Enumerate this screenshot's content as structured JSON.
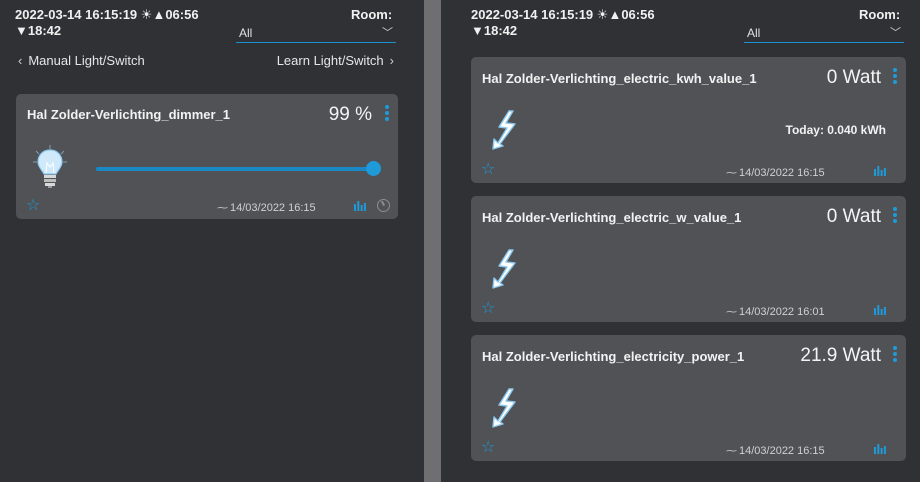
{
  "left": {
    "datetime": "2022-03-14 16:15:19",
    "sunrise": "06:56",
    "sunset": "18:42",
    "room_label": "Room:",
    "room_value": "All",
    "nav_prev": "Manual Light/Switch",
    "nav_next": "Learn Light/Switch",
    "card": {
      "title": "Hal Zolder-Verlichting_dimmer_1",
      "value": "99 %",
      "level_percent": 99,
      "timestamp": "14/03/2022 16:15"
    }
  },
  "right": {
    "datetime": "2022-03-14 16:15:19",
    "sunrise": "06:56",
    "sunset": "18:42",
    "room_label": "Room:",
    "room_value": "All",
    "cards": [
      {
        "title": "Hal Zolder-Verlichting_electric_kwh_value_1",
        "value": "0 Watt",
        "today": "Today: 0.040 kWh",
        "timestamp": "14/03/2022 16:15"
      },
      {
        "title": "Hal Zolder-Verlichting_electric_w_value_1",
        "value": "0 Watt",
        "timestamp": "14/03/2022 16:01"
      },
      {
        "title": "Hal Zolder-Verlichting_electricity_power_1",
        "value": "21.9 Watt",
        "timestamp": "14/03/2022 16:15"
      }
    ]
  },
  "colors": {
    "accent": "#1e9ad9",
    "card": "#505256",
    "background": "#2f3135",
    "divider": "#6f6f72"
  },
  "icons": {
    "sun": "sun-icon",
    "bulb": "lightbulb-icon",
    "bolt": "lightning-icon",
    "star": "star-icon",
    "graph": "bar-chart-icon",
    "timer": "timer-icon"
  }
}
